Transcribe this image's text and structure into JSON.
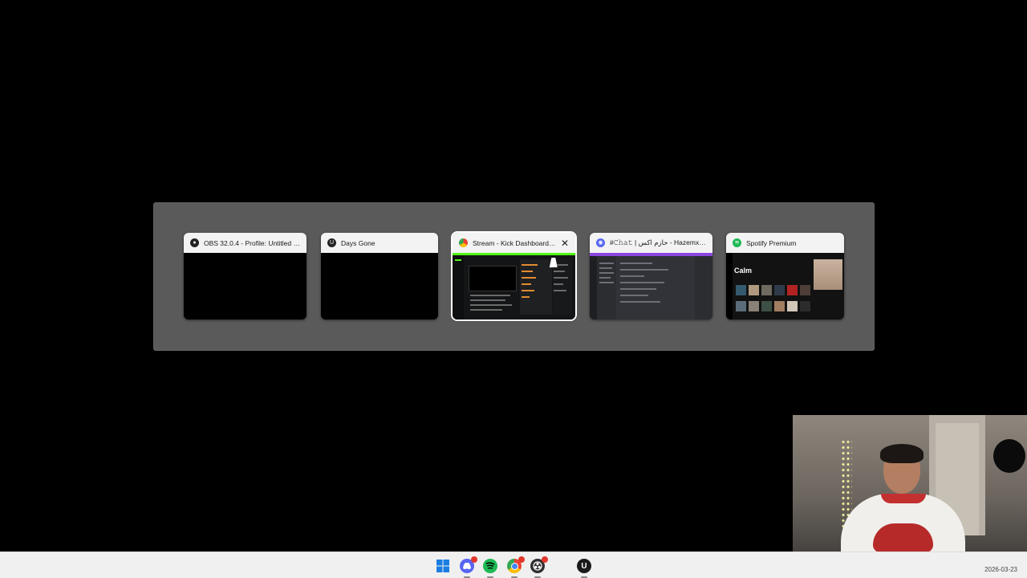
{
  "switcher": {
    "windows": [
      {
        "title": "OBS 32.0.4 - Profile: Untitled - S...",
        "icon": "obs-icon",
        "icon_color": "#222222"
      },
      {
        "title": "Days Gone",
        "icon": "unreal-icon",
        "icon_color": "#222222"
      },
      {
        "title": "Stream - Kick Dashboard -...",
        "icon": "chrome-icon",
        "icon_color": "#34a853",
        "close_glyph": "✕"
      },
      {
        "title": "#𝙲𝚑𝚊𝚝 | حازم اكس - Hazemx - Di...",
        "icon": "discord-icon",
        "icon_color": "#5865f2"
      },
      {
        "title": "Spotify Premium",
        "icon": "spotify-icon",
        "icon_color": "#1db954"
      }
    ],
    "spotify_heading": "Calm",
    "selected_index": 2
  },
  "taskbar": {
    "icons": [
      "windows-start-icon",
      "discord-icon",
      "spotify-icon",
      "chrome-icon",
      "obs-icon",
      "unreal-icon"
    ],
    "date": "2026-03-23"
  },
  "colors": {
    "switcher_bg": "#5a5a5a",
    "kick_accent": "#53fc18",
    "discord_accent": "#8a46e0",
    "spotify_green": "#1db954"
  }
}
